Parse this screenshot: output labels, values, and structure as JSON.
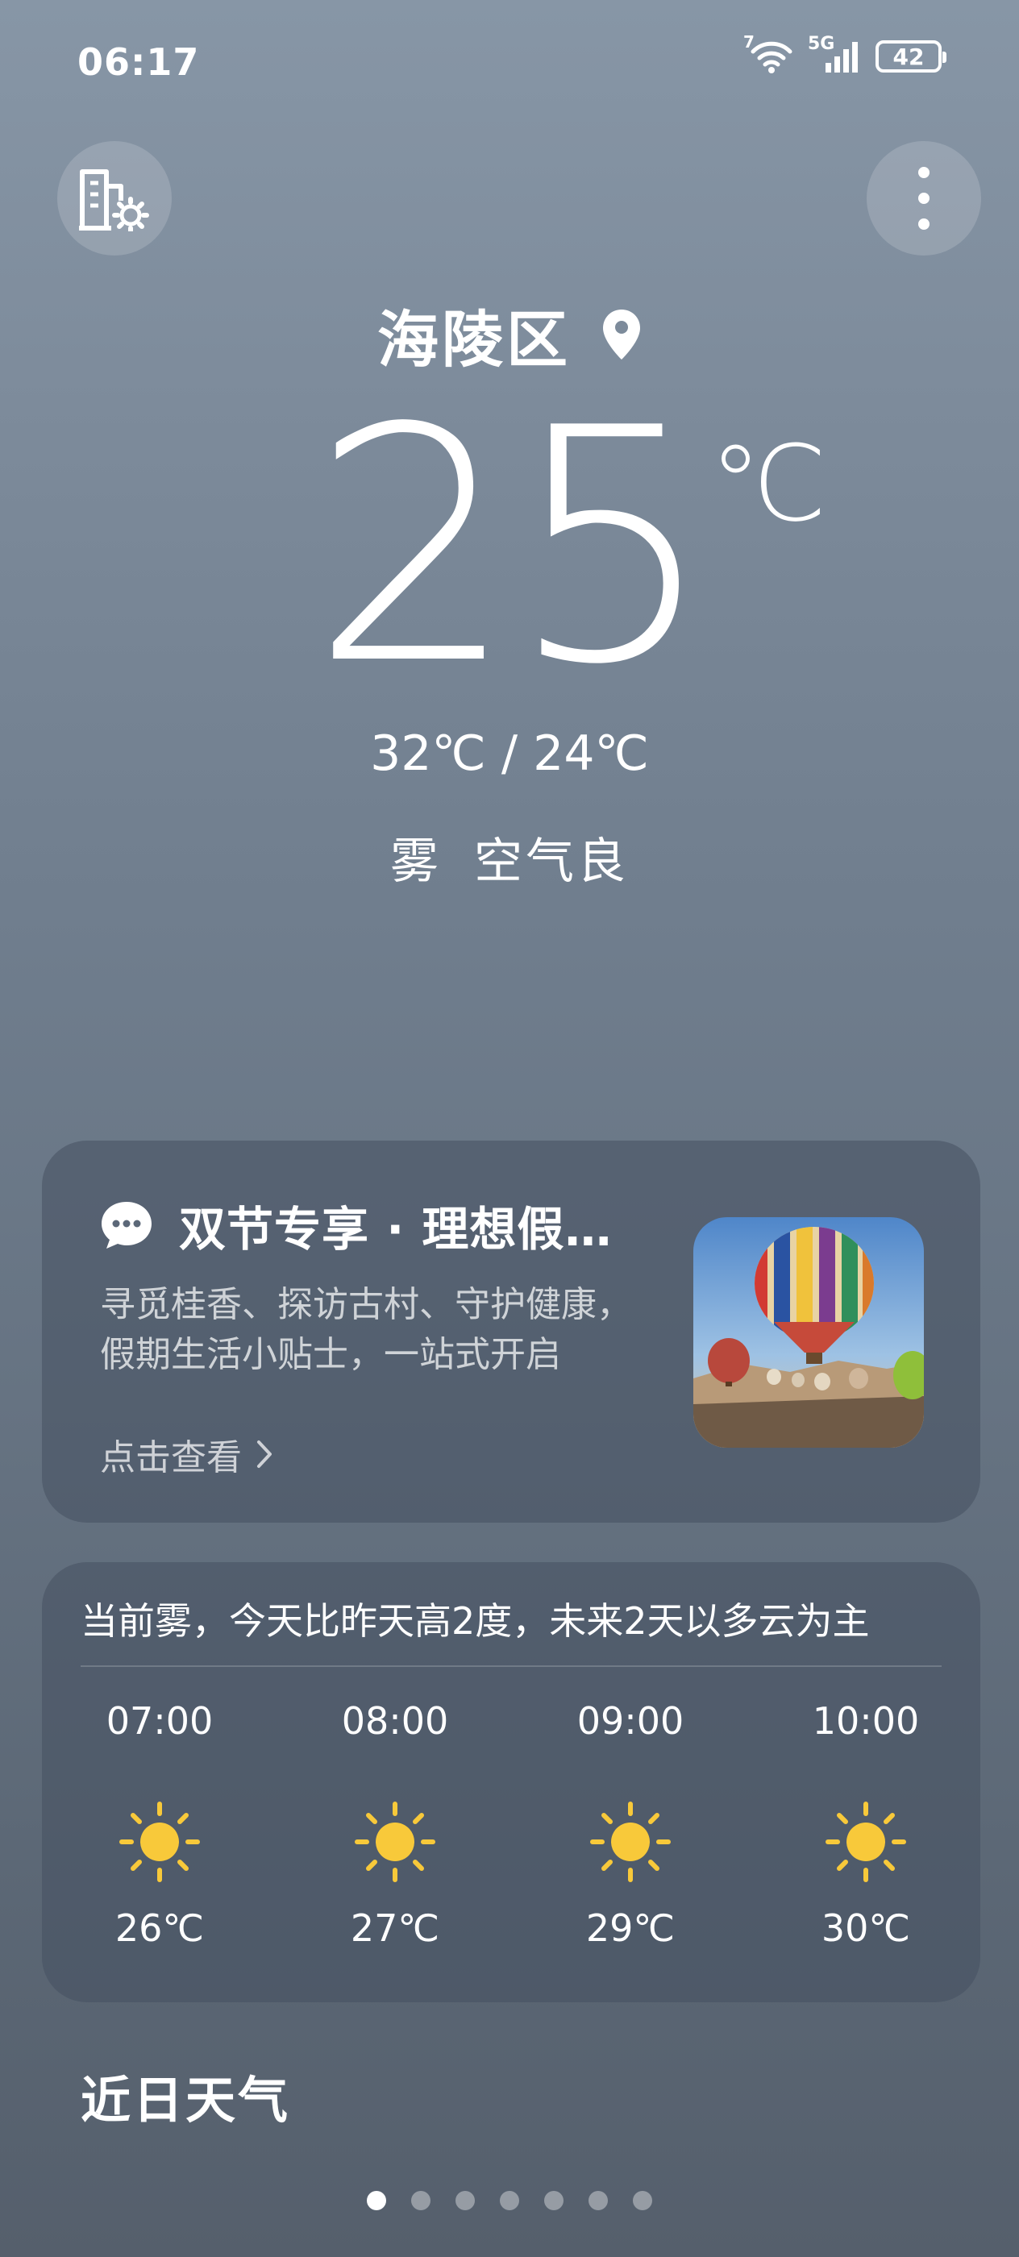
{
  "status_bar": {
    "time": "06:17",
    "wifi_badge": "7",
    "network": "5G",
    "battery": "42",
    "icons": [
      "wifi-icon",
      "signal-icon",
      "battery-icon"
    ]
  },
  "top_bar": {
    "left_icon": "city-settings-icon",
    "right_icon": "more-vertical-icon"
  },
  "location": {
    "name": "海陵区",
    "icon": "location-pin-icon"
  },
  "current": {
    "temp": "25",
    "unit": "℃",
    "hi_lo": "32℃ / 24℃",
    "condition": "雾",
    "air_quality": "空气良"
  },
  "promo": {
    "icon": "chat-bubble-icon",
    "title": "双节专享 · 理想假…",
    "desc_line1": "寻觅桂香、探访古村、守护健康，",
    "desc_line2": "假期生活小贴士，一站式开启",
    "link": "点击查看"
  },
  "hourly": {
    "summary": "当前雾，今天比昨天高2度，未来2天以多云为主",
    "items": [
      {
        "time": "07:00",
        "icon": "sunny-icon",
        "temp": "26℃"
      },
      {
        "time": "08:00",
        "icon": "sunny-icon",
        "temp": "27℃"
      },
      {
        "time": "09:00",
        "icon": "sunny-icon",
        "temp": "29℃"
      },
      {
        "time": "10:00",
        "icon": "sunny-icon",
        "temp": "30℃"
      }
    ]
  },
  "section": {
    "title": "近日天气"
  },
  "pager": {
    "count": 7,
    "active_index": 0
  },
  "colors": {
    "background_top": "#8796a6",
    "background_bottom": "#555f6c",
    "card": "#465060",
    "sun": "#f8c93a"
  }
}
